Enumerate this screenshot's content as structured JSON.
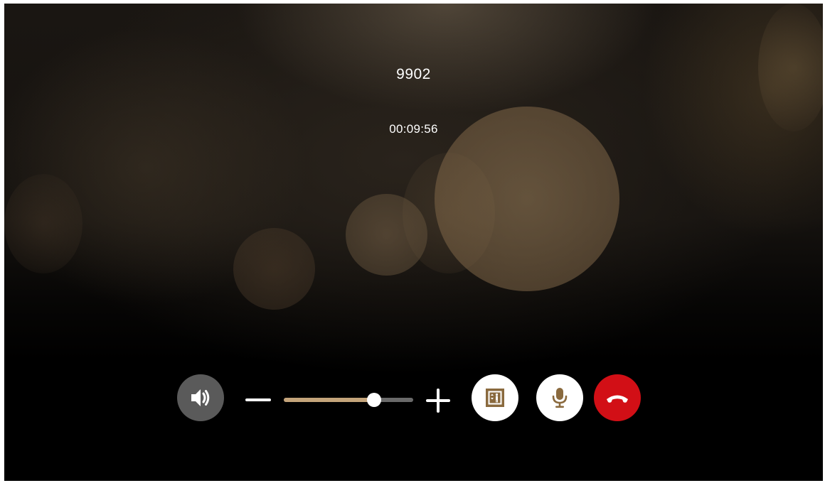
{
  "call": {
    "caller_id": "9902",
    "duration": "00:09:56"
  },
  "controls": {
    "speaker": {
      "icon": "speaker-icon",
      "color": "#5a5a5a"
    },
    "volume": {
      "level": 0.7,
      "min_icon": "minus-icon",
      "max_icon": "plus-icon",
      "fill_color": "#c4a47a",
      "track_color": "#6a6a6a"
    },
    "elevator": {
      "icon": "elevator-icon",
      "color": "#ffffff",
      "accent": "#8a6a3e"
    },
    "microphone": {
      "icon": "microphone-icon",
      "color": "#ffffff",
      "accent": "#8a6a3e"
    },
    "hangup": {
      "icon": "hang-up-icon",
      "color": "#d20f16"
    }
  }
}
